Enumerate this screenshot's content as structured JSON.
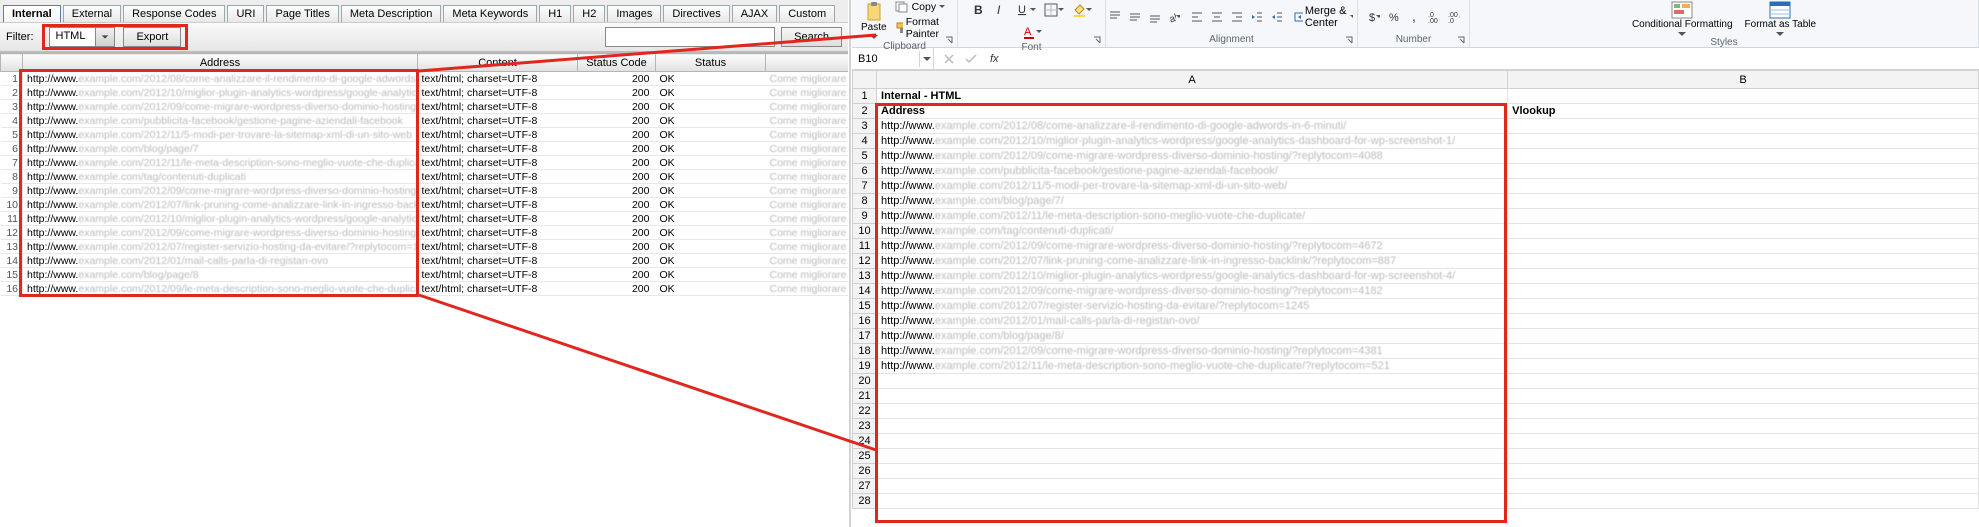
{
  "left": {
    "tabs": [
      "Internal",
      "External",
      "Response Codes",
      "URI",
      "Page Titles",
      "Meta Description",
      "Meta Keywords",
      "H1",
      "H2",
      "Images",
      "Directives",
      "AJAX",
      "Custom"
    ],
    "active_tab_index": 0,
    "filter_label": "Filter:",
    "filter_value": "HTML",
    "export_label": "Export",
    "search_label": "Search",
    "columns": [
      "",
      "Address",
      "Content",
      "Status Code",
      "Status",
      ""
    ],
    "url_prefix": "http://www.",
    "content_value": "text/html; charset=UTF-8",
    "status_code_value": "200",
    "status_value": "OK",
    "row_count": 16
  },
  "excel": {
    "ribbon": {
      "clipboard": {
        "paste": "Paste",
        "copy": "Copy",
        "format_painter": "Format Painter",
        "group": "Clipboard"
      },
      "font": {
        "group": "Font"
      },
      "alignment": {
        "merge": "Merge & Center",
        "group": "Alignment"
      },
      "number": {
        "group": "Number"
      },
      "styles": {
        "conditional": "Conditional Formatting",
        "format_table": "Format as Table",
        "group": "Styles"
      }
    },
    "namebox_value": "B10",
    "fx_label": "fx",
    "col_headers": [
      "A",
      "B"
    ],
    "row1_a": "Internal - HTML",
    "row2_a": "Address",
    "row2_b": "Vlookup",
    "url_prefix": "http://www.",
    "url_row_start": 3,
    "url_row_end": 19
  }
}
